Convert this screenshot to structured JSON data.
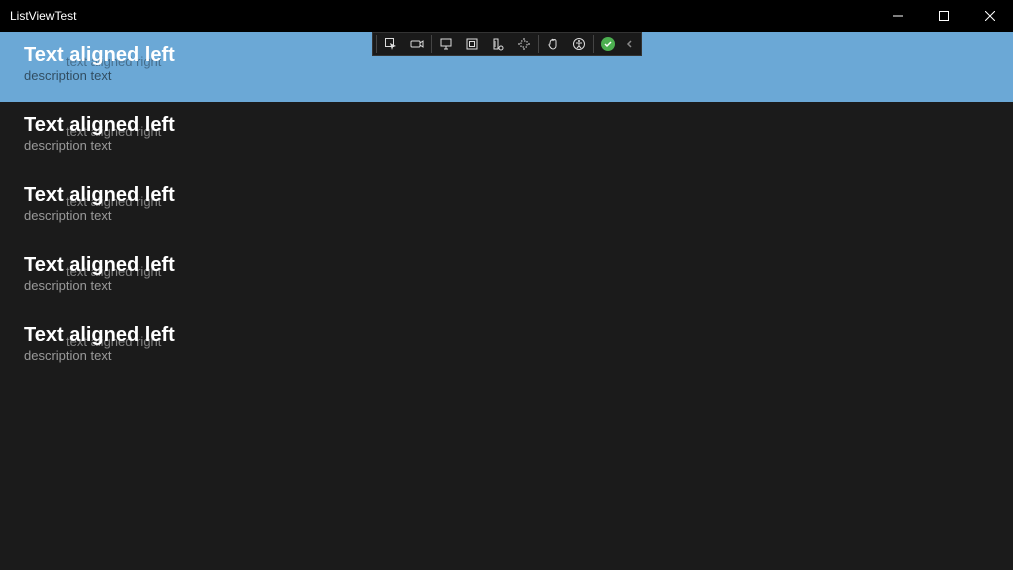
{
  "window": {
    "title": "ListViewTest"
  },
  "devtoolbar": {
    "icons": [
      "select-element",
      "camera",
      "pointer",
      "layout",
      "ruler",
      "guides",
      "hand",
      "accessibility"
    ]
  },
  "list": {
    "items": [
      {
        "title": "Text aligned left",
        "right": "text aligned right",
        "desc": "description text",
        "selected": true
      },
      {
        "title": "Text aligned left",
        "right": "text aligned right",
        "desc": "description text",
        "selected": false
      },
      {
        "title": "Text aligned left",
        "right": "text aligned right",
        "desc": "description text",
        "selected": false
      },
      {
        "title": "Text aligned left",
        "right": "text aligned right",
        "desc": "description text",
        "selected": false
      },
      {
        "title": "Text aligned left",
        "right": "text aligned right",
        "desc": "description text",
        "selected": false
      }
    ]
  }
}
